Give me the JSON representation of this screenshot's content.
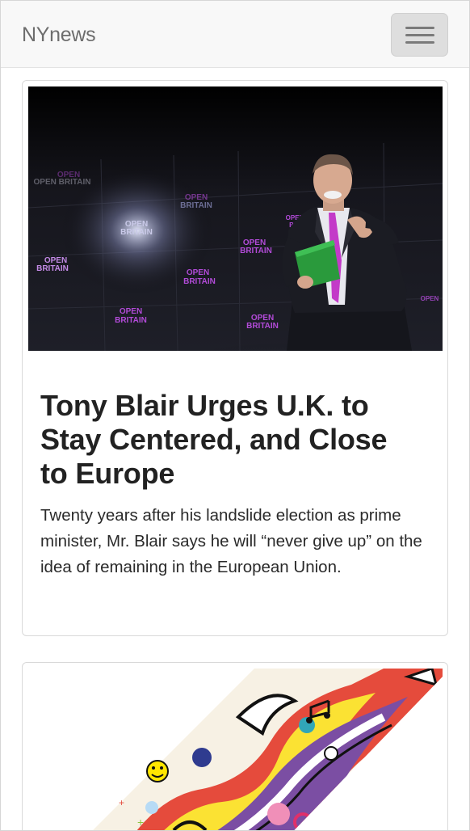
{
  "navbar": {
    "brand": "NYnews",
    "toggle_icon": "hamburger-menu-icon"
  },
  "articles": [
    {
      "image": {
        "subject": "man-speaking-on-stage-photo",
        "backdrop_text": "OPEN BRITAIN"
      },
      "title": "Tony Blair Urges U.K. to Stay Centered, and Close to Europe",
      "summary": "Twenty years after his landslide election as prime minister, Mr. Blair says he will “never give up” on the idea of remaining in the European Union."
    },
    {
      "image": {
        "subject": "colorful-abstract-illustration"
      }
    }
  ],
  "colors": {
    "navbar_bg": "#f8f8f8",
    "brand_text": "#6d6d6d",
    "backdrop_label": "#b24bd8"
  }
}
